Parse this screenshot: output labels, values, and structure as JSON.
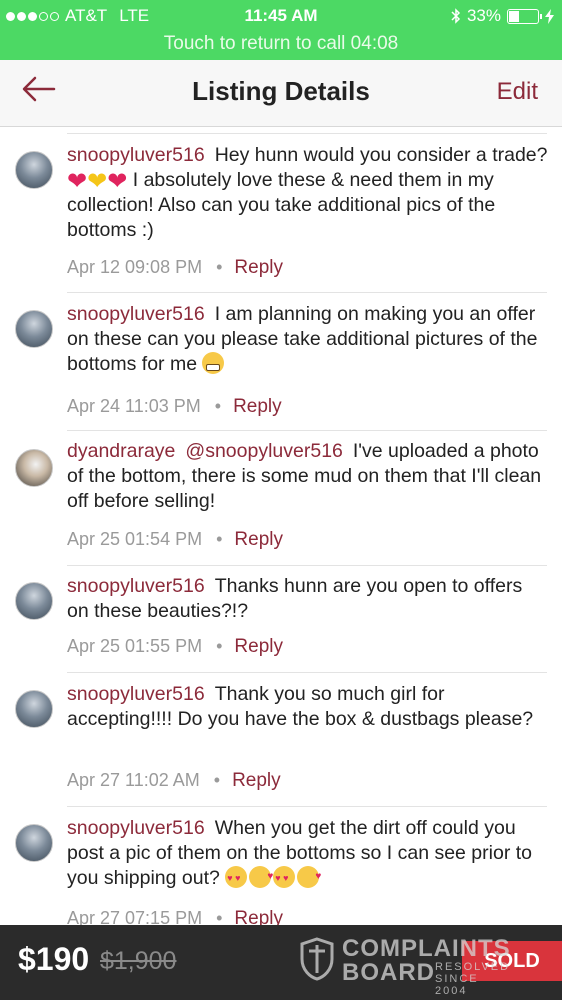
{
  "status_bar": {
    "carrier": "AT&T",
    "network": "LTE",
    "time": "11:45 AM",
    "battery_percent": "33%",
    "battery_level": 0.33,
    "icons": [
      "signal-dots-icon",
      "bluetooth-icon",
      "battery-icon",
      "charging-icon"
    ]
  },
  "call_banner": {
    "text": "Touch to return to call 04:08"
  },
  "nav": {
    "back_icon": "back-arrow-icon",
    "title": "Listing Details",
    "edit_label": "Edit"
  },
  "comments": [
    {
      "user": "snoopyluver516",
      "text_parts": [
        "Hey hunn would you consider a trade? ",
        " I absolutely love these & need them in my collection! Also can you take additional pics of the bottoms :)"
      ],
      "emojis": [
        "red-heart",
        "yellow-heart",
        "red-heart"
      ],
      "date": "Apr 12 09:08 PM",
      "reply_label": "Reply"
    },
    {
      "user": "snoopyluver516",
      "text": "I am planning on making you an offer on these can you please take additional pictures of the bottoms for me",
      "emojis": [
        "grimacing-face"
      ],
      "date": "Apr 24 11:03 PM",
      "reply_label": "Reply"
    },
    {
      "user": "dyandraraye",
      "mention": "@snoopyluver516",
      "text": "I've uploaded a photo of the bottom, there is some mud on them that I'll clean off before selling!",
      "date": "Apr 25 01:54 PM",
      "reply_label": "Reply"
    },
    {
      "user": "snoopyluver516",
      "text": "Thanks hunn are you open to offers on these beauties?!?",
      "date": "Apr 25 01:55 PM",
      "reply_label": "Reply"
    },
    {
      "user": "snoopyluver516",
      "text": "Thank you so much girl for accepting!!!! Do you have the box & dustbags please?",
      "date": "Apr 27 11:02 AM",
      "reply_label": "Reply"
    },
    {
      "user": "snoopyluver516",
      "text": "When you get the dirt off could you post a pic of them on the bottoms so I can see prior to you shipping out?",
      "emojis": [
        "heart-eyes-face",
        "kissing-face",
        "heart-eyes-face",
        "kissing-face"
      ],
      "date": "Apr 27 07:15 PM",
      "reply_label": "Reply"
    }
  ],
  "bottom_bar": {
    "price": "$190",
    "original_price": "$1,900",
    "sold_label": "SOLD"
  },
  "watermark": {
    "line1": "COMPLAINTS",
    "line2": "BOARD",
    "tag1": "RESOLVED",
    "tag2": "SINCE 2004"
  },
  "colors": {
    "status_green": "#4cd964",
    "accent": "#8c2a3a",
    "bottom_bar": "#2b2b2b",
    "sold_red": "#d9343c"
  }
}
